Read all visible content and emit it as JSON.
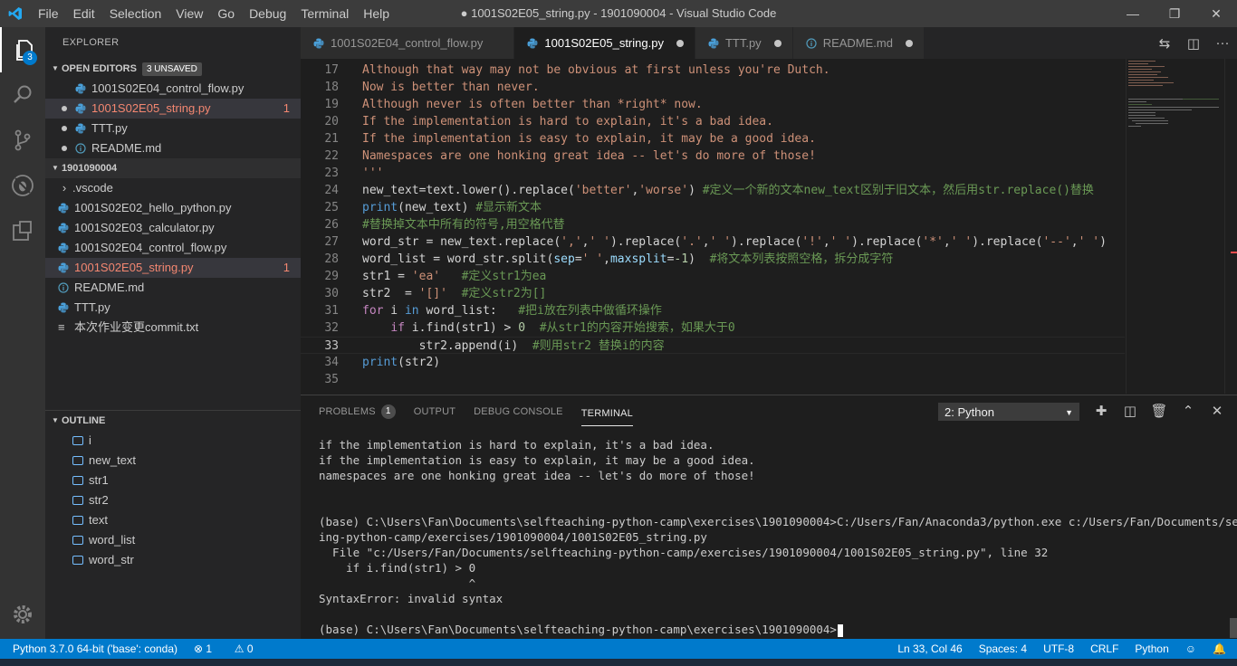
{
  "window": {
    "title": "● 1001S02E05_string.py - 1901090004 - Visual Studio Code",
    "app_icon": "vscode-logo-icon",
    "menu": [
      "File",
      "Edit",
      "Selection",
      "View",
      "Go",
      "Debug",
      "Terminal",
      "Help"
    ],
    "controls": [
      "—",
      "❐",
      "✕"
    ]
  },
  "activity_bar": {
    "explorer_badge": "3",
    "items": [
      "files-icon",
      "search-icon",
      "source-control-icon",
      "debug-icon",
      "extensions-icon"
    ],
    "bottom": "gear-icon"
  },
  "sidebar": {
    "title": "EXPLORER",
    "open_editors": {
      "label": "OPEN EDITORS",
      "unsaved": "3 UNSAVED",
      "items": [
        {
          "name": "1001S02E04_control_flow.py",
          "dirty": false,
          "error": false,
          "count": ""
        },
        {
          "name": "1001S02E05_string.py",
          "dirty": true,
          "error": true,
          "count": "1"
        },
        {
          "name": "TTT.py",
          "dirty": true,
          "error": false,
          "count": ""
        },
        {
          "name": "README.md",
          "dirty": true,
          "error": false,
          "count": ""
        }
      ]
    },
    "folder": {
      "label": "1901090004",
      "items": [
        {
          "name": ".vscode",
          "kind": "folder",
          "error": false,
          "count": ""
        },
        {
          "name": "1001S02E02_hello_python.py",
          "kind": "py",
          "error": false,
          "count": ""
        },
        {
          "name": "1001S02E03_calculator.py",
          "kind": "py",
          "error": false,
          "count": ""
        },
        {
          "name": "1001S02E04_control_flow.py",
          "kind": "py",
          "error": false,
          "count": ""
        },
        {
          "name": "1001S02E05_string.py",
          "kind": "py",
          "error": true,
          "count": "1"
        },
        {
          "name": "README.md",
          "kind": "md",
          "error": false,
          "count": ""
        },
        {
          "name": "TTT.py",
          "kind": "py",
          "error": false,
          "count": ""
        },
        {
          "name": "本次作业变更commit.txt",
          "kind": "txt",
          "error": false,
          "count": ""
        }
      ]
    },
    "outline": {
      "label": "OUTLINE",
      "items": [
        "i",
        "new_text",
        "str1",
        "str2",
        "text",
        "word_list",
        "word_str"
      ]
    }
  },
  "tabs": [
    {
      "name": "1001S02E04_control_flow.py",
      "active": false,
      "dirty": false,
      "icon": "python-icon"
    },
    {
      "name": "1001S02E05_string.py",
      "active": true,
      "dirty": true,
      "icon": "python-icon"
    },
    {
      "name": "TTT.py",
      "active": false,
      "dirty": true,
      "icon": "python-icon"
    },
    {
      "name": "README.md",
      "active": false,
      "dirty": true,
      "icon": "info-icon"
    }
  ],
  "editor": {
    "current_line": 33,
    "lines": [
      {
        "n": "17",
        "text": "Although that way may not be obvious at first unless you're Dutch."
      },
      {
        "n": "18",
        "text": "Now is better than never."
      },
      {
        "n": "19",
        "text": "Although never is often better than *right* now."
      },
      {
        "n": "20",
        "text": "If the implementation is hard to explain, it's a bad idea."
      },
      {
        "n": "21",
        "text": "If the implementation is easy to explain, it may be a good idea."
      },
      {
        "n": "22",
        "text": "Namespaces are one honking great idea -- let's do more of those!"
      },
      {
        "n": "23",
        "text": "'''"
      },
      {
        "n": "24",
        "text": "new_text=text.lower().replace('better','worse') #定义一个新的文本new_text区别于旧文本，然后用str.replace()替换"
      },
      {
        "n": "25",
        "text": "print(new_text) #显示新文本"
      },
      {
        "n": "26",
        "text": "#替换掉文本中所有的符号,用空格代替"
      },
      {
        "n": "27",
        "text": "word_str = new_text.replace(',',' ').replace('.',' ').replace('!',' ').replace('*',' ').replace('--',' ')"
      },
      {
        "n": "28",
        "text": "word_list = word_str.split(sep=' ',maxsplit=-1)  #将文本列表按照空格，拆分成字符"
      },
      {
        "n": "29",
        "text": "str1 = 'ea'   #定义str1为ea"
      },
      {
        "n": "30",
        "text": "str2  = '[]'  #定义str2为[]"
      },
      {
        "n": "31",
        "text": "for i in word_list:   #把i放在列表中做循环操作"
      },
      {
        "n": "32",
        "text": "    if i.find(str1) > 0  #从str1的内容开始搜索，如果大于0"
      },
      {
        "n": "33",
        "text": "        str2.append(i)  #则用str2 替换i的内容"
      },
      {
        "n": "34",
        "text": "print(str2)"
      },
      {
        "n": "35",
        "text": ""
      }
    ]
  },
  "panel": {
    "tabs": [
      {
        "label": "PROBLEMS",
        "badge": "1",
        "active": false
      },
      {
        "label": "OUTPUT",
        "badge": "",
        "active": false
      },
      {
        "label": "DEBUG CONSOLE",
        "badge": "",
        "active": false
      },
      {
        "label": "TERMINAL",
        "badge": "",
        "active": true
      }
    ],
    "terminal_select": "2: Python",
    "actions": [
      "plus-icon",
      "split-icon",
      "trash-icon",
      "chevron-up-icon",
      "close-icon"
    ],
    "terminal_lines": [
      "if the implementation is hard to explain, it's a bad idea.",
      "if the implementation is easy to explain, it may be a good idea.",
      "namespaces are one honking great idea -- let's do more of those!",
      "",
      "",
      "(base) C:\\Users\\Fan\\Documents\\selfteaching-python-camp\\exercises\\1901090004>C:/Users/Fan/Anaconda3/python.exe c:/Users/Fan/Documents/selfteach",
      "ing-python-camp/exercises/1901090004/1001S02E05_string.py",
      "  File \"c:/Users/Fan/Documents/selfteaching-python-camp/exercises/1901090004/1001S02E05_string.py\", line 32",
      "    if i.find(str1) > 0",
      "                      ^",
      "SyntaxError: invalid syntax",
      "",
      "(base) C:\\Users\\Fan\\Documents\\selfteaching-python-camp\\exercises\\1901090004>"
    ]
  },
  "statusbar": {
    "interpreter": "Python 3.7.0 64-bit ('base': conda)",
    "errors": "⊗ 1",
    "warnings": "⚠ 0",
    "position": "Ln 33, Col 46",
    "spaces": "Spaces: 4",
    "encoding": "UTF-8",
    "eol": "CRLF",
    "language": "Python"
  },
  "colors": {
    "accent": "#007acc",
    "error": "#f48771",
    "string": "#ce9178",
    "comment": "#6a9955"
  }
}
